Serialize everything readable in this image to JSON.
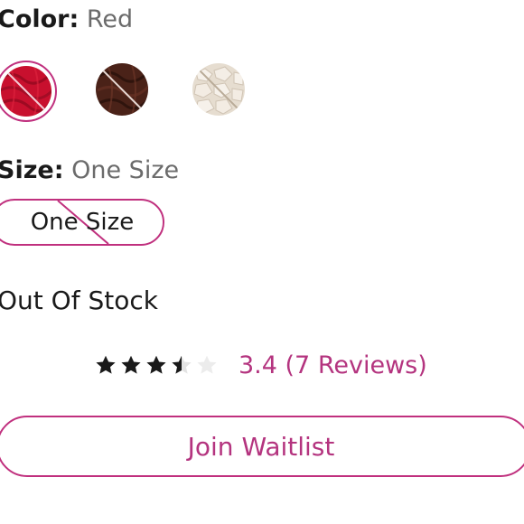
{
  "color": {
    "label": "Color:",
    "selected": "Red",
    "swatches": [
      {
        "name": "Red",
        "color": "#c8102e",
        "selected": true,
        "available": false
      },
      {
        "name": "Brown",
        "color": "#4a2218",
        "selected": false,
        "available": false
      },
      {
        "name": "Cream",
        "color": "#e6ddd0",
        "selected": false,
        "available": false
      }
    ]
  },
  "size": {
    "label": "Size:",
    "selected": "One Size",
    "options": [
      "One Size"
    ]
  },
  "stock": {
    "status": "Out Of Stock"
  },
  "rating": {
    "value": 3.4,
    "max": 5,
    "reviews_text": "3.4 (7 Reviews)"
  },
  "waitlist": {
    "label": "Join Waitlist"
  },
  "colors": {
    "accent": "#c0307e",
    "accent_text": "#b4347f",
    "star_filled": "#1a1a1a",
    "star_empty": "#e3e3e3",
    "muted_text": "#6b6b6b"
  }
}
